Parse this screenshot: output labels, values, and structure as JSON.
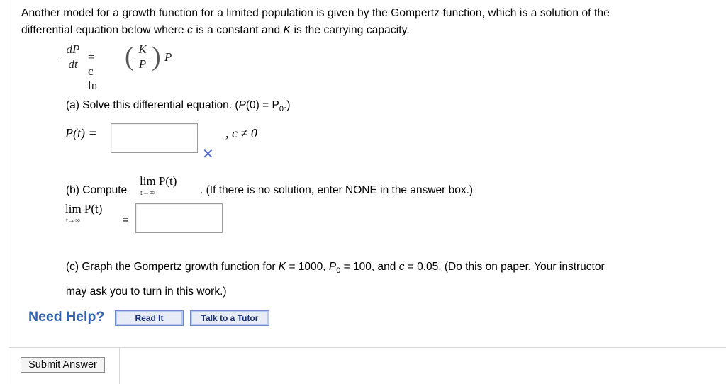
{
  "intro": {
    "line1": "Another model for a growth function for a limited population is given by the Gompertz function, which is a solution of the",
    "line2_pre": "differential equation below where ",
    "c": "c",
    "line2_mid": " is a constant and ",
    "K": "K",
    "line2_post": " is the carrying capacity."
  },
  "equation": {
    "dP": "dP",
    "dt": "dt",
    "eq": "= c ln",
    "K": "K",
    "P": "P",
    "P_tail": "P"
  },
  "part_a": {
    "label": "(a) Solve this differential equation. (",
    "P0": "P",
    "rest": "(0) = P",
    "sub0": "0",
    "end": ".)",
    "answer_label": "P(t) =",
    "answer_value": "",
    "condition": ", c ≠ 0"
  },
  "part_b": {
    "label": "(b) Compute ",
    "lim": "lim P(t)",
    "lim_sub": "t→∞",
    "rest": ". (If there is no solution, enter NONE in the answer box.)",
    "lim2": "lim P(t)",
    "lim2_sub": "t→∞",
    "eq": "=",
    "answer_value": ""
  },
  "part_c": {
    "text1": "(c) Graph the Gompertz growth function for ",
    "K": "K",
    "t2": " = 1000, ",
    "P": "P",
    "sub0": "0",
    "t3": " = 100, and ",
    "c": "c",
    "t4": " = 0.05. (Do this on paper. Your instructor",
    "line2": "may ask you to turn in this work.)"
  },
  "help": {
    "title": "Need Help?",
    "read_it": "Read It",
    "talk": "Talk to a Tutor"
  },
  "submit": "Submit Answer",
  "colors": {
    "help": "#2f63b3",
    "x_mark": "#5b6fd1"
  }
}
